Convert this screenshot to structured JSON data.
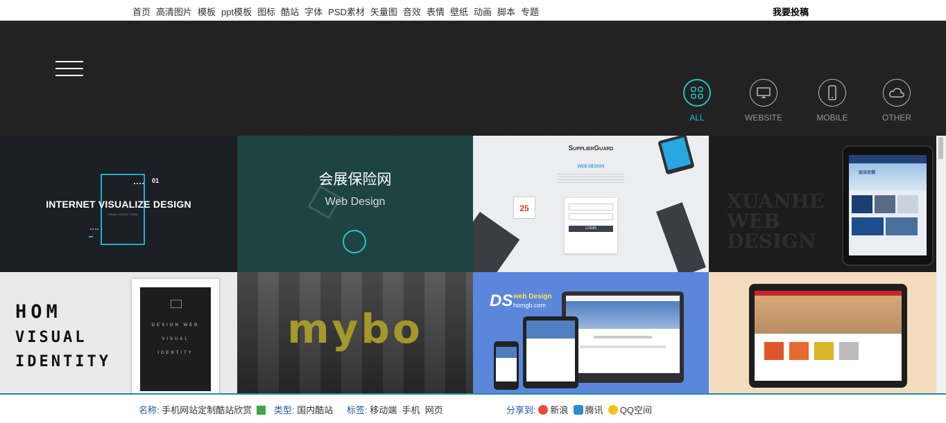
{
  "topnav": [
    "首页",
    "高清图片",
    "模板",
    "ppt模板",
    "图标",
    "酷站",
    "字体",
    "PSD素材",
    "矢量图",
    "音效",
    "表情",
    "壁纸",
    "动画",
    "脚本",
    "专题"
  ],
  "submit_label": "我要投稿",
  "filters": [
    {
      "label": "ALL",
      "icon": "grid-icon",
      "active": true
    },
    {
      "label": "WEBSITE",
      "icon": "monitor-icon",
      "active": false
    },
    {
      "label": "MOBILE",
      "icon": "phone-icon",
      "active": false
    },
    {
      "label": "OTHER",
      "icon": "cloud-icon",
      "active": false
    }
  ],
  "tiles": {
    "t1": {
      "title": "INTERNET VISUALIZE DESIGN",
      "num": "01",
      "sub": "VISUAL STUDIO THOM"
    },
    "t2": {
      "title": "会展保险网",
      "subtitle": "Web Design"
    },
    "t3": {
      "brand": "SupplierGuard",
      "sub": "WEB DESIGN",
      "day": "25",
      "login": "LOGIN"
    },
    "t4": {
      "letters": "XUANHE WEB DESIGN",
      "screen_title": "会法合规"
    },
    "t5": {
      "l1": "HOM",
      "l2": "VISUAL",
      "l3": "IDENTITY",
      "poster": "DESIGN WEB VISUAL IDENTITY"
    },
    "t6": {
      "logo": "mybo"
    },
    "t7": {
      "ds": "DS",
      "wd": "web Design",
      "site": "homgb.com"
    },
    "t8": {}
  },
  "footer": {
    "name_label": "名称:",
    "name_value": "手机网站定制酷站欣赏",
    "type_label": "类型:",
    "type_value": "国内酷站",
    "tag_label": "标签:",
    "tags": [
      "移动端",
      "手机",
      "网页"
    ],
    "share_label": "分享到:",
    "share": [
      "新浪",
      "腾讯",
      "QQ空间"
    ]
  }
}
